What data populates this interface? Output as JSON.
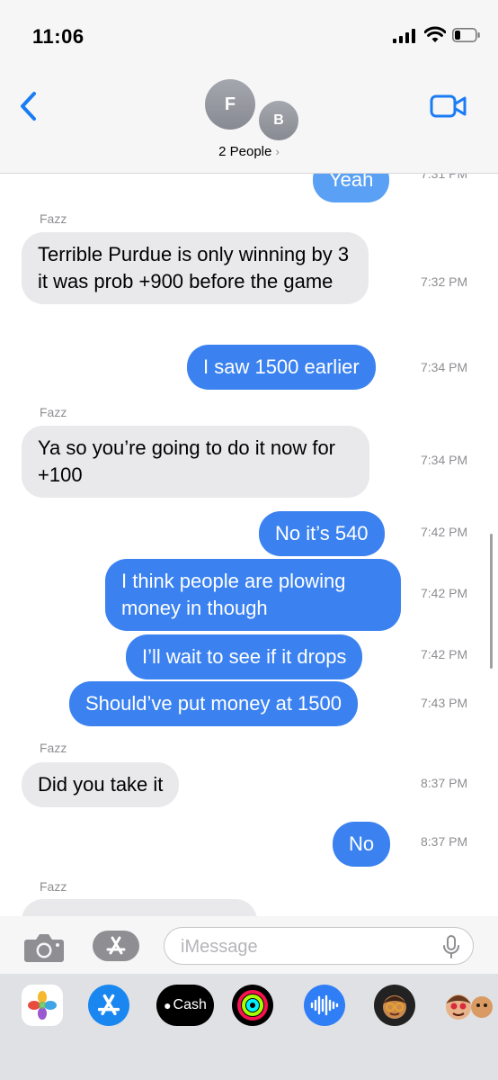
{
  "status_bar": {
    "time": "11:06"
  },
  "header": {
    "avatars": [
      "F",
      "B"
    ],
    "people_label": "2 People",
    "chevron": "›"
  },
  "messages": [
    {
      "sender": "",
      "text": "Yeah",
      "time": "7:31 PM",
      "from": "me"
    },
    {
      "sender": "Fazz",
      "text": "Terrible Purdue is only winning by 3 it was prob +900 before the game",
      "time": "7:32 PM",
      "from": "them"
    },
    {
      "sender": "",
      "text": "I saw 1500 earlier",
      "time": "7:34 PM",
      "from": "me"
    },
    {
      "sender": "Fazz",
      "text": "Ya so you’re going to do it now for +100",
      "time": "7:34 PM",
      "from": "them"
    },
    {
      "sender": "",
      "text": "No it’s 540",
      "time": "7:42 PM",
      "from": "me"
    },
    {
      "sender": "",
      "text": "I think people are plowing money in though",
      "time": "7:42 PM",
      "from": "me"
    },
    {
      "sender": "",
      "text": "I’ll wait to see if it drops",
      "time": "7:42 PM",
      "from": "me"
    },
    {
      "sender": "",
      "text": "Should’ve put money at 1500",
      "time": "7:43 PM",
      "from": "me"
    },
    {
      "sender": "Fazz",
      "text": "Did you take it",
      "time": "8:37 PM",
      "from": "them"
    },
    {
      "sender": "",
      "text": "No",
      "time": "8:37 PM",
      "from": "me"
    },
    {
      "sender": "Fazz",
      "text": "",
      "time": "",
      "from": "them"
    }
  ],
  "composer": {
    "placeholder": "iMessage"
  },
  "app_tray": {
    "cash_label": "Cash",
    "icons": [
      "photos-icon",
      "app-store-icon",
      "apple-cash-icon",
      "activity-icon",
      "audio-message-icon",
      "memoji-icon",
      "memoji-stickers-icon"
    ]
  },
  "colors": {
    "blue_bubble": "#3b82f0",
    "gray_bubble": "#e9e9eb",
    "accent": "#1a7cf5"
  }
}
